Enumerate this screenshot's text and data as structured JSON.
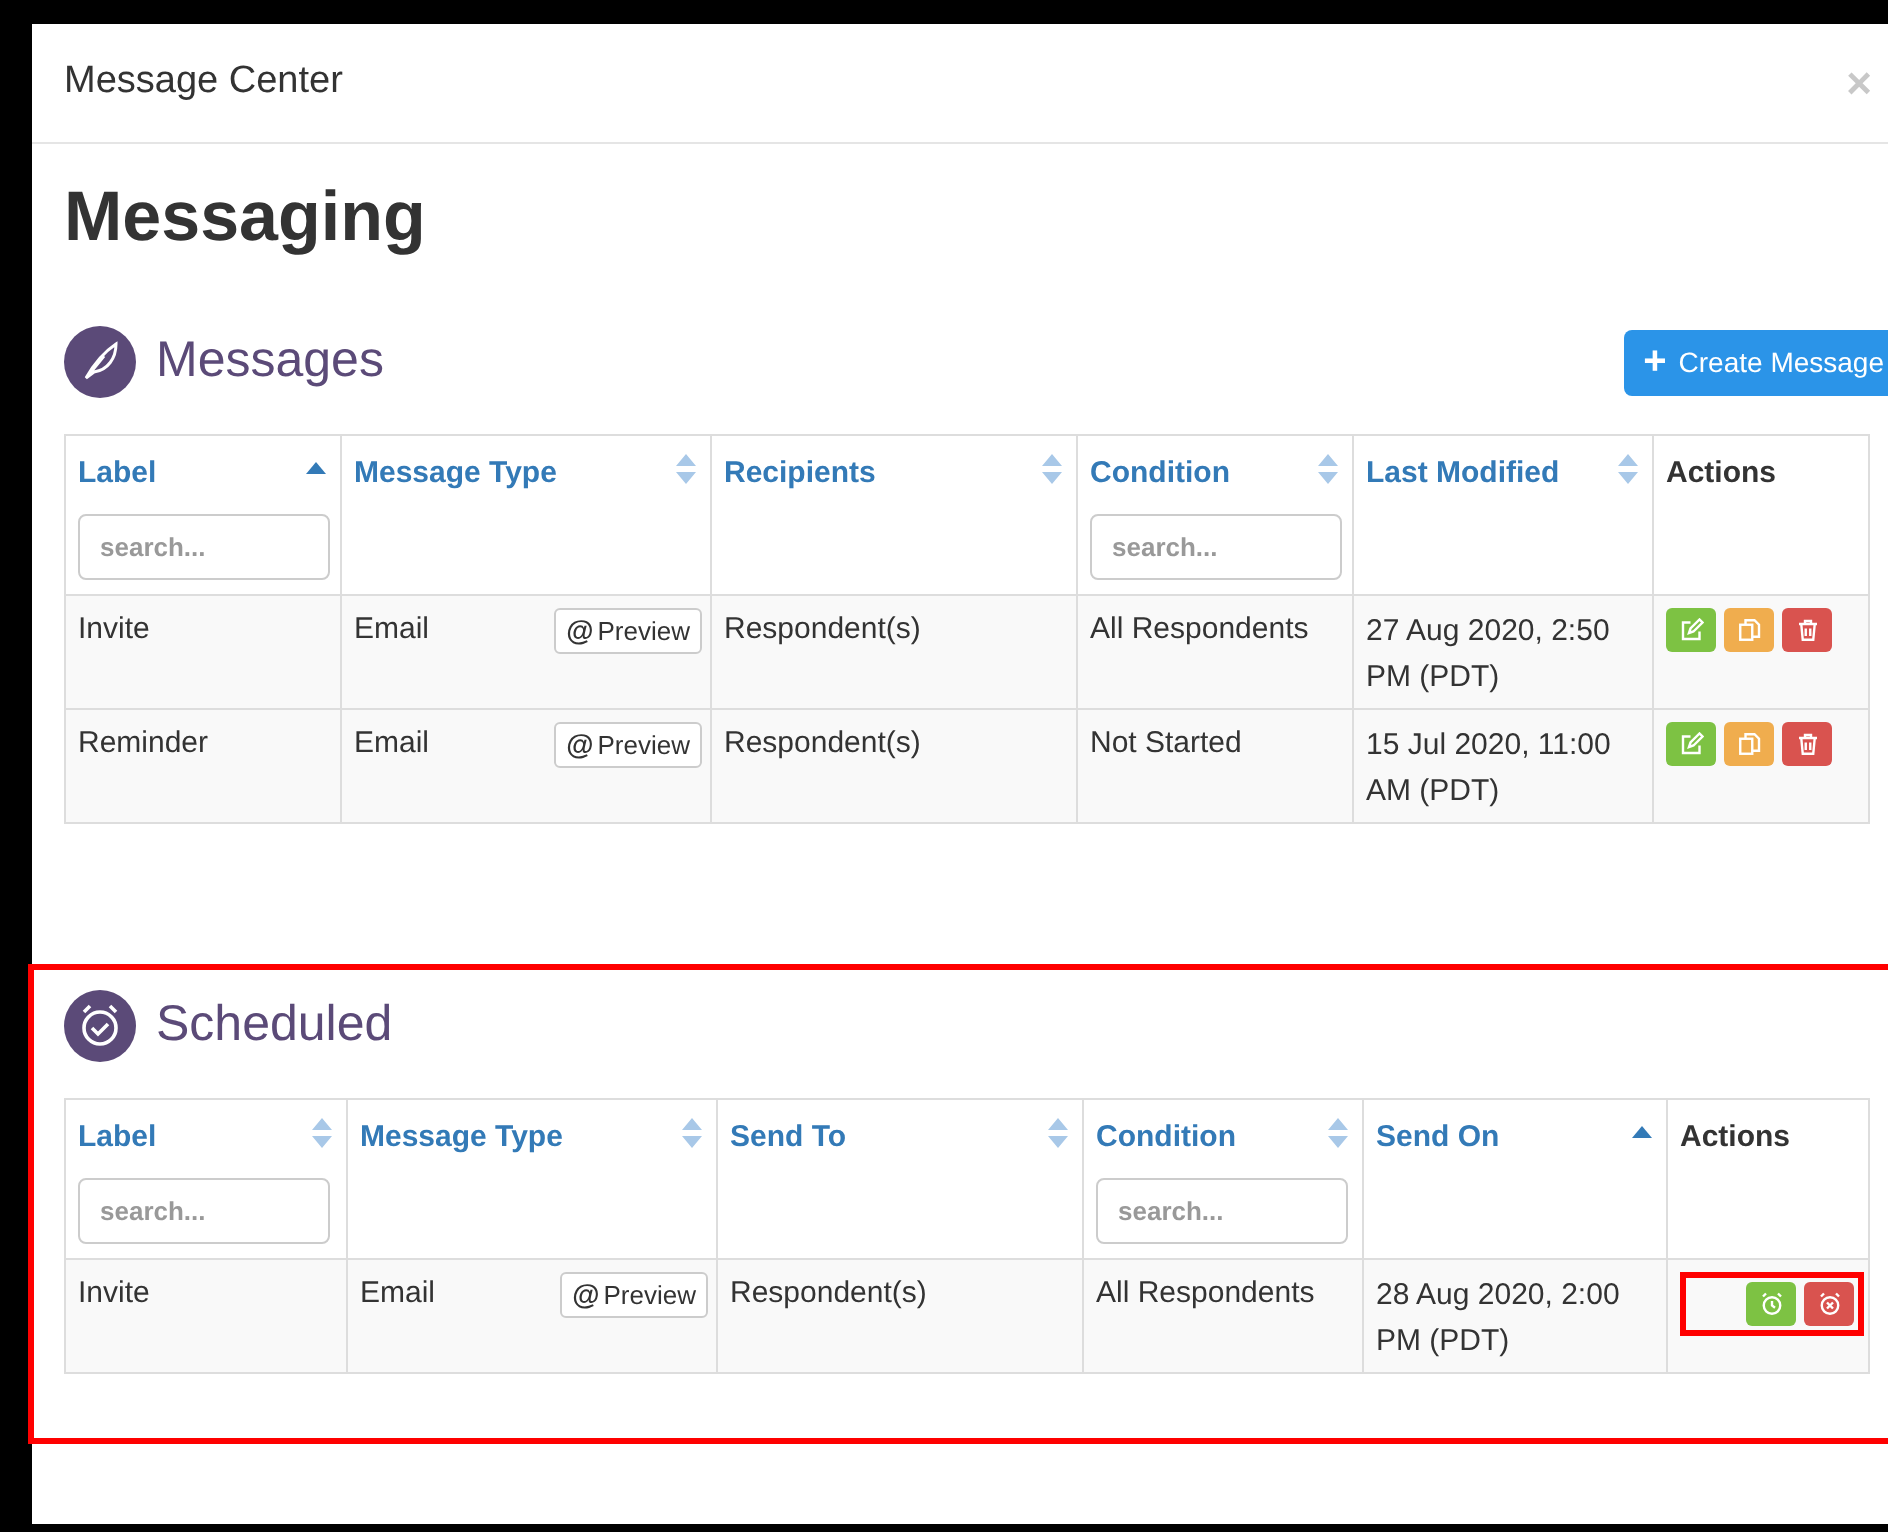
{
  "dialog": {
    "title": "Message Center",
    "close": "×"
  },
  "heading": "Messaging",
  "sections": [
    {
      "kind": "messages",
      "title": "Messages",
      "highlighted": false,
      "create_button": {
        "icon": "+",
        "label": "Create Message"
      },
      "columns": [
        {
          "label": "Label",
          "sortable": true,
          "sorted": true,
          "search": {
            "placeholder": "search..."
          }
        },
        {
          "label": "Message Type",
          "sortable": true,
          "sorted": false
        },
        {
          "label": "Recipients",
          "sortable": true,
          "sorted": false
        },
        {
          "label": "Condition",
          "sortable": true,
          "sorted": false,
          "search": {
            "placeholder": "search..."
          }
        },
        {
          "label": "Last Modified",
          "sortable": true,
          "sorted": false
        },
        {
          "label": "Actions"
        }
      ],
      "rows": [
        {
          "label": "Invite",
          "type": "Email",
          "preview": {
            "icon": "@",
            "label": "Preview"
          },
          "recipients": "Respondent(s)",
          "condition": "All Respondents",
          "date": "27 Aug 2020, 2:50 PM (PDT)",
          "actions_highlighted": false,
          "actions": [
            {
              "kind": "edit",
              "color": "#7dc243"
            },
            {
              "kind": "copy",
              "color": "#f0ad4e"
            },
            {
              "kind": "delete",
              "color": "#d9534f"
            }
          ]
        },
        {
          "label": "Reminder",
          "type": "Email",
          "preview": {
            "icon": "@",
            "label": "Preview"
          },
          "recipients": "Respondent(s)",
          "condition": "Not Started",
          "date": "15 Jul 2020, 11:00 AM (PDT)",
          "actions_highlighted": false,
          "actions": [
            {
              "kind": "edit",
              "color": "#7dc243"
            },
            {
              "kind": "copy",
              "color": "#f0ad4e"
            },
            {
              "kind": "delete",
              "color": "#d9534f"
            }
          ]
        }
      ]
    },
    {
      "kind": "scheduled",
      "title": "Scheduled",
      "highlighted": true,
      "columns": [
        {
          "label": "Label",
          "sortable": true,
          "sorted": false,
          "search": {
            "placeholder": "search..."
          }
        },
        {
          "label": "Message Type",
          "sortable": true,
          "sorted": false
        },
        {
          "label": "Send To",
          "sortable": true,
          "sorted": false
        },
        {
          "label": "Condition",
          "sortable": true,
          "sorted": false,
          "search": {
            "placeholder": "search..."
          }
        },
        {
          "label": "Send On",
          "sortable": true,
          "sorted": true
        },
        {
          "label": "Actions"
        }
      ],
      "rows": [
        {
          "label": "Invite",
          "type": "Email",
          "preview": {
            "icon": "@",
            "label": "Preview"
          },
          "recipients": "Respondent(s)",
          "condition": "All Respondents",
          "date": "28 Aug 2020, 2:00 PM (PDT)",
          "actions_highlighted": true,
          "actions": [
            {
              "kind": "schedule",
              "color": "#7dc243"
            },
            {
              "kind": "cancel",
              "color": "#d9534f"
            }
          ]
        }
      ]
    }
  ]
}
